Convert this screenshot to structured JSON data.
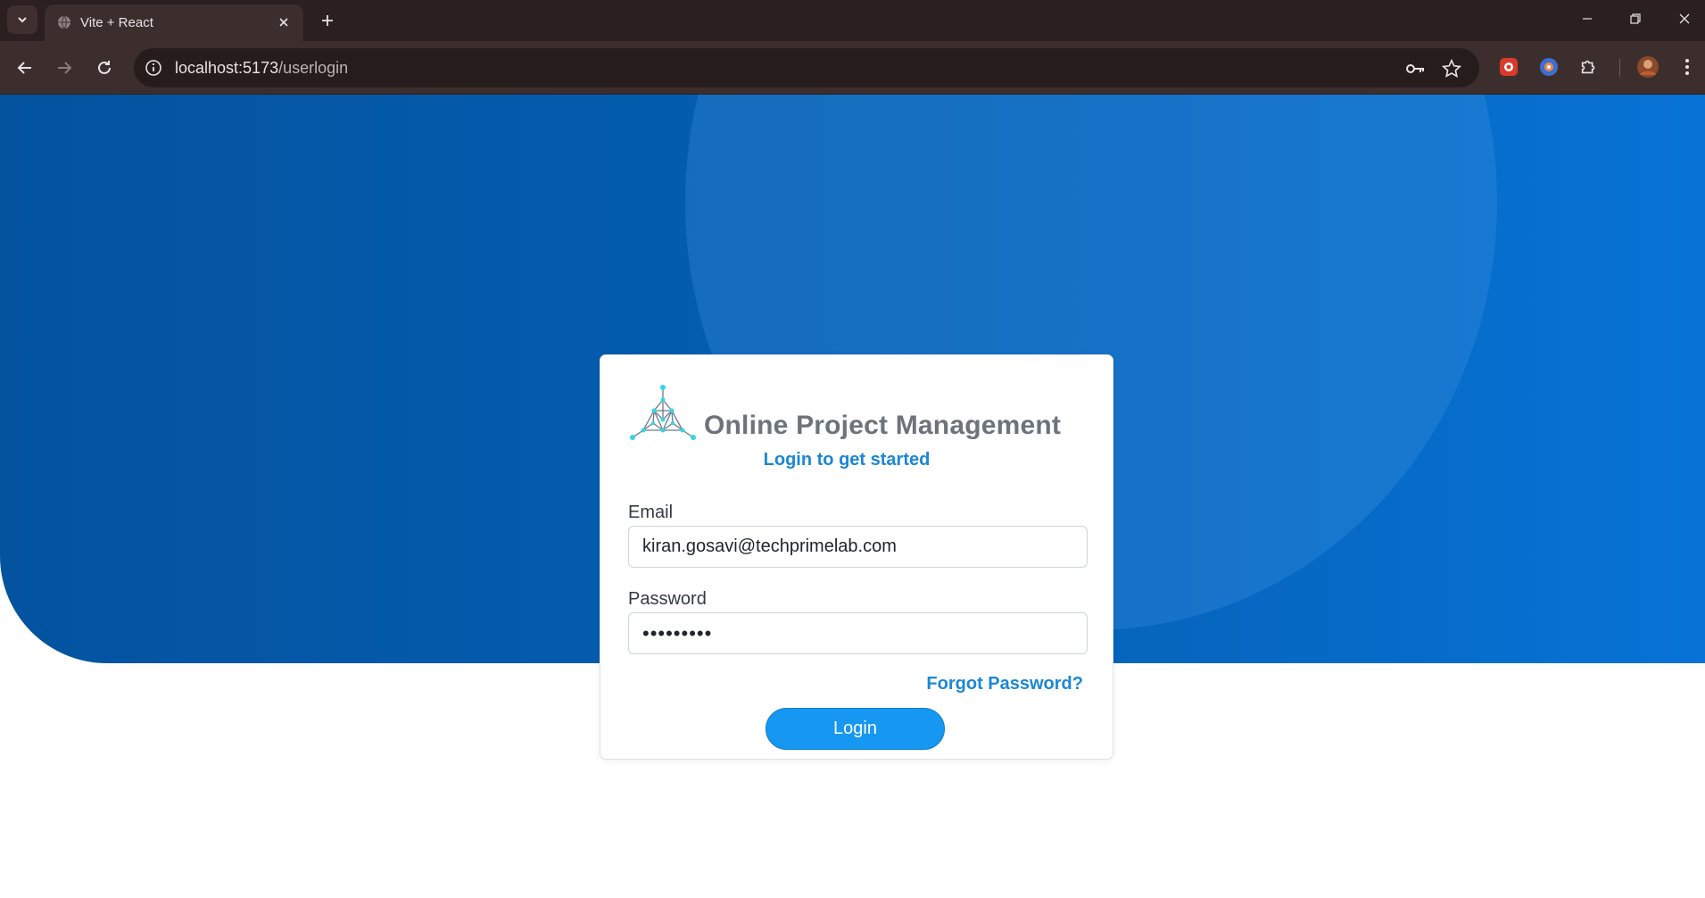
{
  "browser": {
    "tab_title": "Vite + React",
    "url_host": "localhost:5173",
    "url_path": "/userlogin"
  },
  "app": {
    "brand_name": "Online Project Management",
    "subtitle": "Login to get started"
  },
  "login_form": {
    "email_label": "Email",
    "email_value": "kiran.gosavi@techprimelab.com",
    "password_label": "Password",
    "password_value": "•••••••••",
    "forgot_password": "Forgot Password?",
    "login_button": "Login"
  },
  "colors": {
    "hero_gradient_start": "#03539f",
    "hero_gradient_end": "#0773d6",
    "accent_link": "#1b87d6",
    "button": "#1597f2",
    "brand_text": "#6c737a",
    "logo_cyan": "#33d6e6"
  }
}
